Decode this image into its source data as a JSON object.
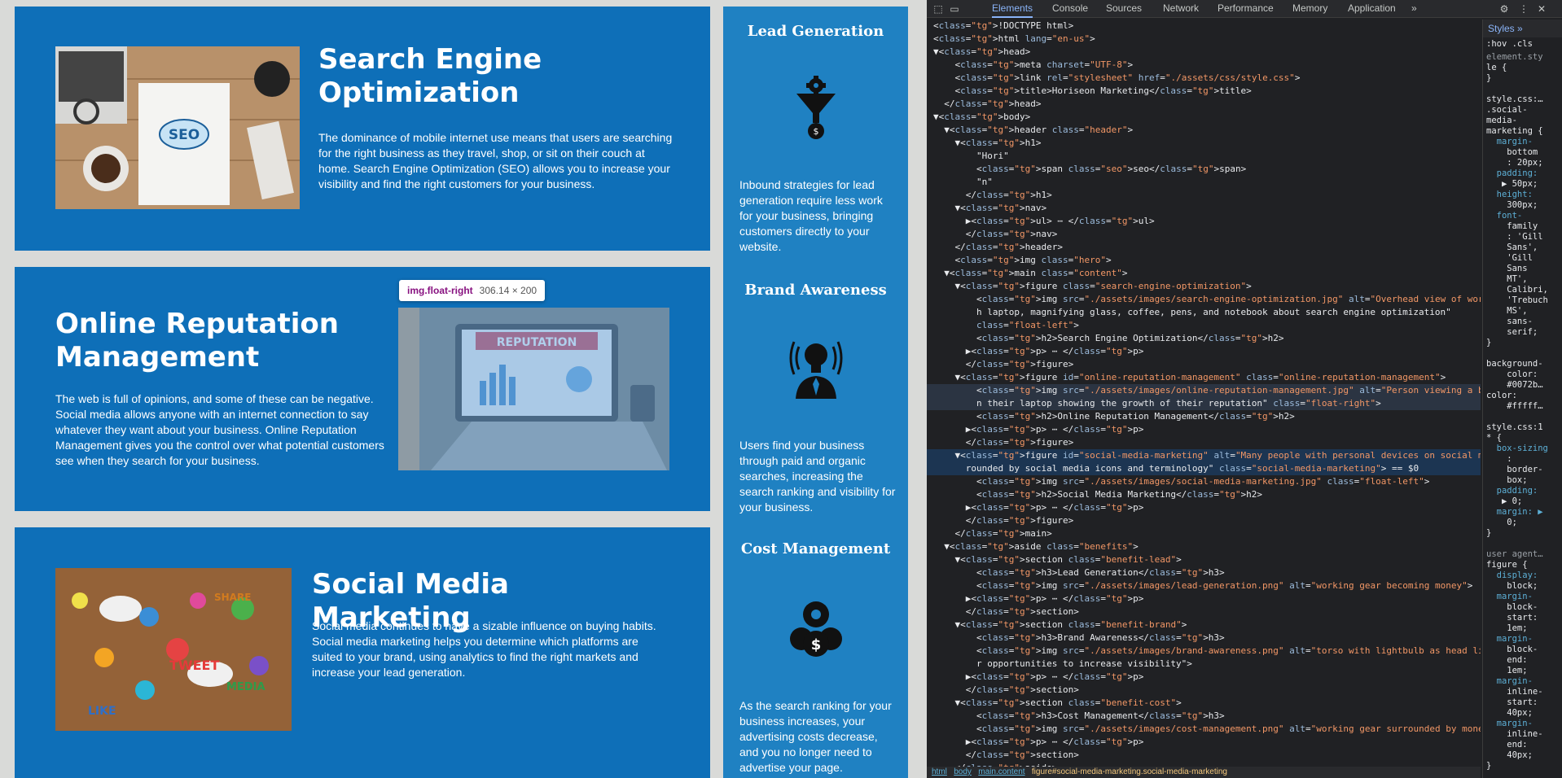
{
  "site": {
    "seo": {
      "title": "Search Engine Optimization",
      "text": "The dominance of mobile internet use means that users are searching for the right business as they travel, shop, or sit on their couch at home. Search Engine Optimization (SEO) allows you to increase your visibility and find the right customers for your business.",
      "image_alt": "Overhead view of workspace with laptop, magnifying glass, coffee, pens, and notebook about search engine optimization"
    },
    "orm": {
      "title": "Online Reputation Management",
      "text": "The web is full of opinions, and some of these can be negative. Social media allows anyone with an internet connection to say whatever they want about your business. Online Reputation Management gives you the control over what potential customers see when they search for your business.",
      "image_alt": "Person viewing a bar graph on their laptop showing the growth of their reputation"
    },
    "smm": {
      "title": "Social Media Marketing",
      "text": "Social media continues to have a sizable influence on buying habits. Social media marketing helps you determine which platforms are suited to your brand, using analytics to find the right markets and increase your lead generation."
    },
    "benefits": [
      {
        "title": "Lead Generation",
        "text": "Inbound strategies for lead generation require less work for your business, bringing customers directly to your website.",
        "icon": "gear-funnel-money-icon"
      },
      {
        "title": "Brand Awareness",
        "text": "Users find your business through paid and organic searches, increasing the search ranking and visibility for your business.",
        "icon": "lightbulb-head-icon"
      },
      {
        "title": "Cost Management",
        "text": "As the search ranking for your business increases, your advertising costs decrease, and you no longer need to advertise your page.",
        "icon": "gears-money-icon"
      }
    ],
    "inspect_tip": {
      "tag": "img",
      "cls": ".float-right",
      "size": "306.14 × 200"
    }
  },
  "devtools": {
    "tabs": [
      "Elements",
      "Console",
      "Sources",
      "Network",
      "Performance",
      "Memory",
      "Application"
    ],
    "active_tab": "Elements",
    "more": "»",
    "icons": [
      "inspect-icon",
      "device-toolbar-icon",
      "settings-icon",
      "more-options-icon",
      "close-icon"
    ],
    "breadcrumb": [
      "html",
      "body",
      "main.content",
      "figure#social-media-marketing.social-media-marketing"
    ],
    "styles": {
      "tab": "Styles",
      "more": "»",
      "filter": ":hov .cls",
      "lines": [
        "element.sty",
        "le {",
        "}",
        "",
        "style.css:…",
        ".social-",
        "media-",
        "marketing {",
        "  margin-",
        "    bottom",
        "    : 20px;",
        "  padding:",
        "   ▶ 50px;",
        "  height:",
        "    300px;",
        "  font-",
        "    family",
        "    : 'Gill",
        "    Sans',",
        "    'Gill",
        "    Sans",
        "    MT',",
        "    Calibri,",
        "    'Trebuch",
        "    MS',",
        "    sans-",
        "    serif;",
        "}",
        "",
        "background-",
        "    color:",
        "    #0072b…",
        "color:",
        "    #fffff…",
        "",
        "style.css:1",
        "* {",
        "  box-sizing",
        "    :",
        "    border-",
        "    box;",
        "  padding:",
        "   ▶ 0;",
        "  margin: ▶",
        "    0;",
        "}",
        "",
        "user agent…",
        "figure {",
        "  display:",
        "    block;",
        "  margin-",
        "    block-",
        "    start:",
        "    1em;",
        "  margin-",
        "    block-",
        "    end:",
        "    1em;",
        "  margin-",
        "    inline-",
        "    start:",
        "    40px;",
        "  margin-",
        "    inline-",
        "    end:",
        "    40px;",
        "}"
      ]
    },
    "code_lines": [
      "<!DOCTYPE html>",
      "<html lang=\"en-us\">",
      "▼<head>",
      "    <meta charset=\"UTF-8\">",
      "    <link rel=\"stylesheet\" href=\"./assets/css/style.css\">",
      "    <title>Horiseon Marketing</title>",
      "  </head>",
      "▼<body>",
      "  ▼<header class=\"header\">",
      "    ▼<h1>",
      "        \"Hori\"",
      "        <span class=\"seo\">seo</span>",
      "        \"n\"",
      "      </h1>",
      "    ▼<nav>",
      "      ▶<ul> ⋯ </ul>",
      "      </nav>",
      "    </header>",
      "    <img class=\"hero\">",
      "  ▼<main class=\"content\">",
      "    ▼<figure class=\"search-engine-optimization\">",
      "        <img src=\"./assets/images/search-engine-optimization.jpg\" alt=\"Overhead view of workspace wit",
      "        h laptop, magnifying glass, coffee, pens, and notebook about search engine optimization\"",
      "        class=\"float-left\">",
      "        <h2>Search Engine Optimization</h2>",
      "      ▶<p> ⋯ </p>",
      "      </figure>",
      "    ▼<figure id=\"online-reputation-management\" class=\"online-reputation-management\">",
      "        <img src=\"./assets/images/online-reputation-management.jpg\" alt=\"Person viewing a bar graph o",
      "        n their laptop showing the growth of their reputation\" class=\"float-right\">",
      "        <h2>Online Reputation Management</h2>",
      "      ▶<p> ⋯ </p>",
      "      </figure>",
      "    ▼<figure id=\"social-media-marketing\" alt=\"Many people with personal devices on social media, sur",
      "      rounded by social media icons and terminology\" class=\"social-media-marketing\"> == $0",
      "        <img src=\"./assets/images/social-media-marketing.jpg\" class=\"float-left\">",
      "        <h2>Social Media Marketing</h2>",
      "      ▶<p> ⋯ </p>",
      "      </figure>",
      "    </main>",
      "  ▼<aside class=\"benefits\">",
      "    ▼<section class=\"benefit-lead\">",
      "        <h3>Lead Generation</h3>",
      "        <img src=\"./assets/images/lead-generation.png\" alt=\"working gear becoming money\">",
      "      ▶<p> ⋯ </p>",
      "      </section>",
      "    ▼<section class=\"benefit-brand\">",
      "        <h3>Brand Awareness</h3>",
      "        <img src=\"./assets/images/brand-awareness.png\" alt=\"torso with lightbulb as head listening fo",
      "        r opportunities to increase visibility\">",
      "      ▶<p> ⋯ </p>",
      "      </section>",
      "    ▼<section class=\"benefit-cost\">",
      "        <h3>Cost Management</h3>",
      "        <img src=\"./assets/images/cost-management.png\" alt=\"working gear surrounded by money\">",
      "      ▶<p> ⋯ </p>",
      "      </section>",
      "    </aside>"
    ]
  }
}
